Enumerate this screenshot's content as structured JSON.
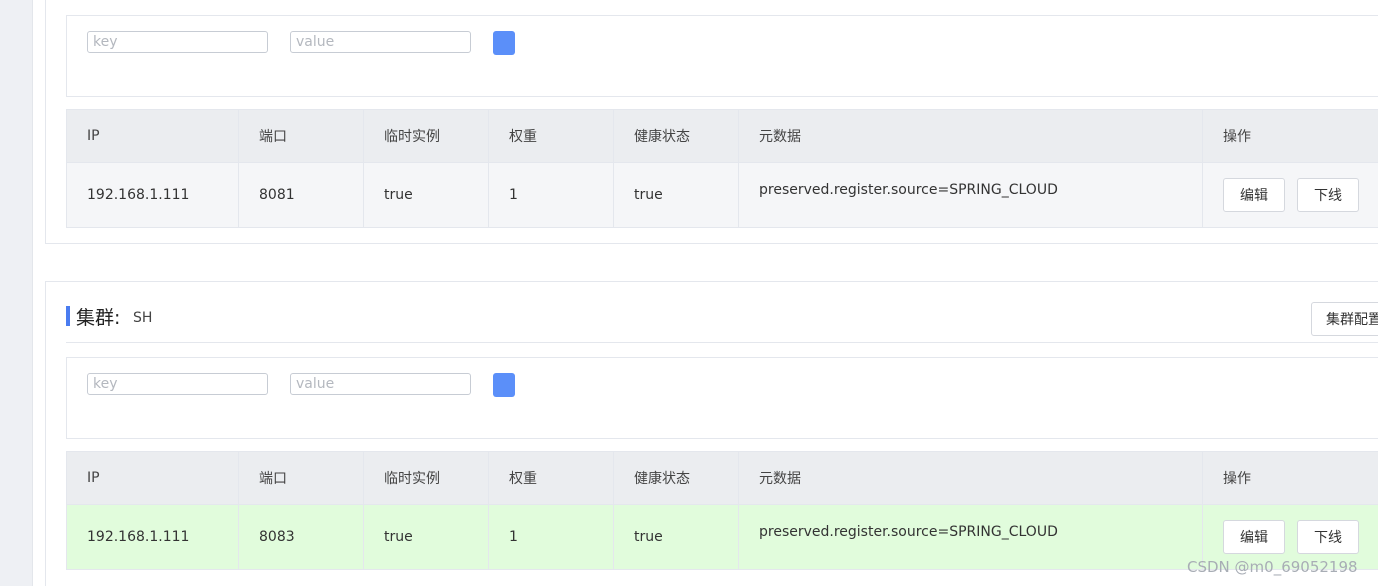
{
  "filter": {
    "key_placeholder": "key",
    "value_placeholder": "value"
  },
  "table": {
    "headers": [
      "IP",
      "端口",
      "临时实例",
      "权重",
      "健康状态",
      "元数据",
      "操作"
    ]
  },
  "clusters": [
    {
      "row": {
        "ip": "192.168.1.111",
        "port": "8081",
        "ephemeral": "true",
        "weight": "1",
        "healthy": "true",
        "metadata": "preserved.register.source=SPRING_CLOUD",
        "edit_label": "编辑",
        "offline_label": "下线"
      }
    },
    {
      "label": "集群:",
      "name": "SH",
      "config_label": "集群配置",
      "row": {
        "ip": "192.168.1.111",
        "port": "8083",
        "ephemeral": "true",
        "weight": "1",
        "healthy": "true",
        "metadata": "preserved.register.source=SPRING_CLOUD",
        "edit_label": "编辑",
        "offline_label": "下线"
      }
    }
  ],
  "watermark": "CSDN @m0_69052198",
  "colors": {
    "accent": "#4a7cf0",
    "filter_button": "#5b8ff9",
    "header_bg": "#ebedf0",
    "row_gray": "#f5f6f8",
    "row_green": "#e1fcdc"
  }
}
